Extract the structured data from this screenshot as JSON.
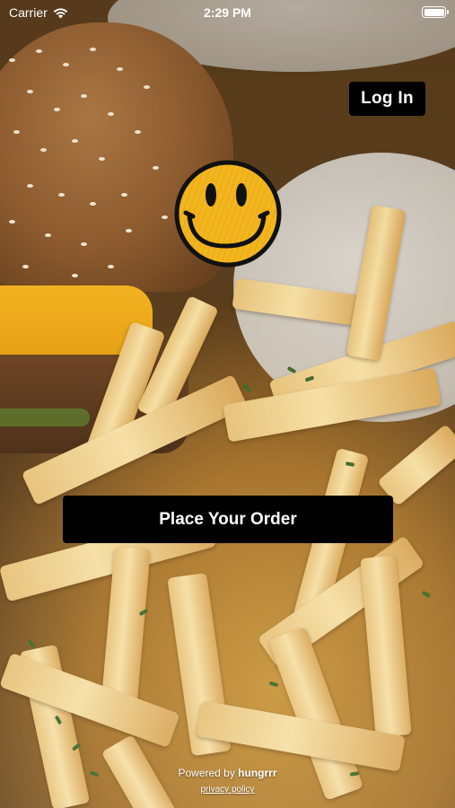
{
  "status_bar": {
    "carrier": "Carrier",
    "time": "2:29 PM",
    "wifi_icon": "wifi-icon",
    "battery_icon": "battery-icon"
  },
  "header": {
    "login_label": "Log In"
  },
  "logo": {
    "icon": "smiley-face-icon",
    "color": "#f2b51e"
  },
  "main": {
    "order_label": "Place Your Order"
  },
  "footer": {
    "powered_prefix": "Powered by ",
    "powered_brand": "hungrrr",
    "privacy_label": "privacy policy"
  },
  "colors": {
    "button_bg": "#000000",
    "button_text": "#ffffff"
  }
}
